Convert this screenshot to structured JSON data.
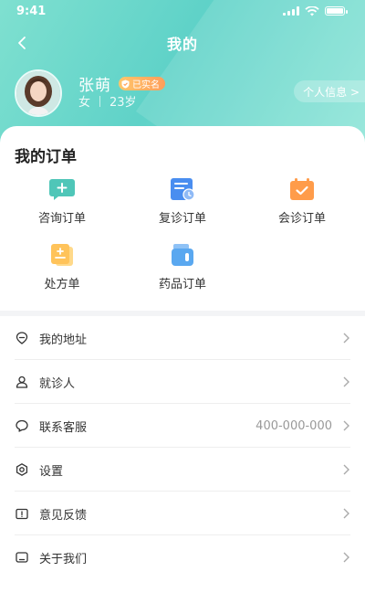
{
  "status_bar": {
    "time": "9:41"
  },
  "nav": {
    "title": "我的"
  },
  "profile": {
    "name": "张萌",
    "verified_badge": "已实名",
    "gender": "女",
    "age": "23岁",
    "info_button": "个人信息 >"
  },
  "orders": {
    "title": "我的订单",
    "items": [
      {
        "label": "咨询订单",
        "icon": "consult-order-icon",
        "color": "#4fc6b8"
      },
      {
        "label": "复诊订单",
        "icon": "revisit-order-icon",
        "color": "#4a8ef0"
      },
      {
        "label": "会诊订单",
        "icon": "consultation-order-icon",
        "color": "#ff9c4a"
      },
      {
        "label": "处方单",
        "icon": "prescription-icon",
        "color": "#ffc35a"
      },
      {
        "label": "药品订单",
        "icon": "medicine-order-icon",
        "color": "#5aa8f0"
      }
    ]
  },
  "menu": {
    "items": [
      {
        "label": "我的地址",
        "icon": "location-icon"
      },
      {
        "label": "就诊人",
        "icon": "person-icon"
      },
      {
        "label": "联系客服",
        "icon": "chat-icon",
        "value": "400-000-000"
      },
      {
        "label": "设置",
        "icon": "settings-icon"
      },
      {
        "label": "意见反馈",
        "icon": "feedback-icon"
      },
      {
        "label": "关于我们",
        "icon": "about-icon"
      }
    ]
  },
  "colors": {
    "header_gradient_start": "#7fe0d0",
    "header_gradient_end": "#5fd2c8",
    "badge": "#ff9e5a"
  }
}
